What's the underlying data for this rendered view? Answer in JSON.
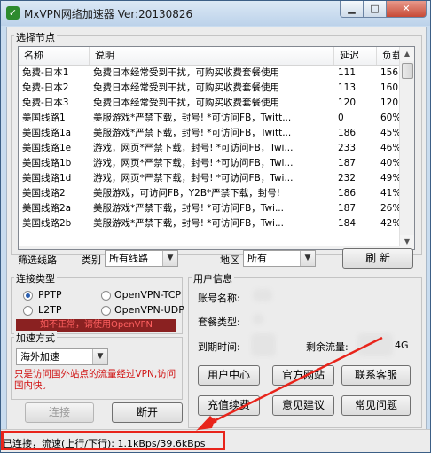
{
  "window": {
    "title": "MxVPN网络加速器 Ver:20130826"
  },
  "node_group": {
    "label": "选择节点",
    "columns": [
      "名称",
      "说明",
      "延迟",
      "负载"
    ],
    "rows": [
      {
        "name": "免费-日本1",
        "desc": "免费日本经常受到干扰，可购买收费套餐使用",
        "delay": "111",
        "load": "156"
      },
      {
        "name": "免费-日本2",
        "desc": "免费日本经常受到干扰，可购买收费套餐使用",
        "delay": "113",
        "load": "160"
      },
      {
        "name": "免费-日本3",
        "desc": "免费日本经常受到干扰，可购买收费套餐使用",
        "delay": "120",
        "load": "120"
      },
      {
        "name": "美国线路1",
        "desc": "美服游戏*严禁下载，封号! *可访问FB，Twitt...",
        "delay": "0",
        "load": "60%"
      },
      {
        "name": "美国线路1a",
        "desc": "美服游戏*严禁下载，封号! *可访问FB，Twitt...",
        "delay": "186",
        "load": "45%"
      },
      {
        "name": "美国线路1e",
        "desc": "游戏，网页*严禁下载，封号! *可访问FB，Twi...",
        "delay": "233",
        "load": "46%"
      },
      {
        "name": "美国线路1b",
        "desc": "游戏，网页*严禁下载，封号! *可访问FB，Twi...",
        "delay": "187",
        "load": "40%"
      },
      {
        "name": "美国线路1d",
        "desc": "游戏，网页*严禁下载，封号! *可访问FB，Twi...",
        "delay": "232",
        "load": "49%"
      },
      {
        "name": "美国线路2",
        "desc": "美服游戏，可访问FB，Y2B*严禁下载，封号!",
        "delay": "186",
        "load": "41%"
      },
      {
        "name": "美国线路2a",
        "desc": "美服游戏*严禁下载，封号! *可访问FB，Twi...",
        "delay": "187",
        "load": "26%"
      },
      {
        "name": "美国线路2b",
        "desc": "美服游戏*严禁下载，封号! *可访问FB，Twi...",
        "delay": "184",
        "load": "42%"
      }
    ]
  },
  "filter": {
    "label": "筛选线路",
    "type_label": "类别",
    "type_value": "所有线路",
    "region_label": "地区",
    "region_value": "所有",
    "refresh_label": "刷 新"
  },
  "connection_type": {
    "label": "连接类型",
    "options": [
      "PPTP",
      "OpenVPN-TCP",
      "L2TP",
      "OpenVPN-UDP"
    ],
    "selected": "PPTP",
    "warning": "如不正常，请使用OpenVPN"
  },
  "accel": {
    "label": "加速方式",
    "value": "海外加速",
    "note": "只是访问国外站点的流量经过VPN,访问国内快。"
  },
  "user_info": {
    "label": "用户信息",
    "account_label": "账号名称:",
    "package_label": "套餐类型:",
    "expire_label": "到期时间:",
    "traffic_label": "剩余流量:",
    "traffic_suffix": "4G"
  },
  "buttons": {
    "user_center": "用户中心",
    "official_site": "官方网站",
    "contact_support": "联系客服",
    "recharge": "充值续费",
    "feedback": "意见建议",
    "faq": "常见问题",
    "connect": "连接",
    "disconnect": "断开"
  },
  "status": {
    "text": "已连接，流速(上行/下行): 1.1kBps/39.6kBps"
  },
  "colors": {
    "highlight": "#e8241b",
    "warning_bg": "#8a2121",
    "warning_text": "#ff6060",
    "note_text": "#d01010"
  }
}
